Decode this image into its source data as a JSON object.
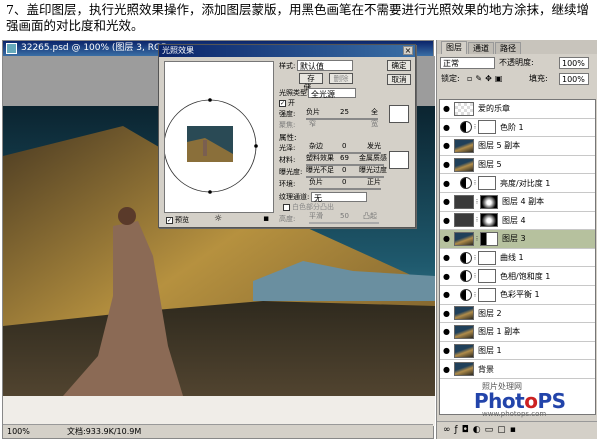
{
  "instruction": "7、盖印图层，执行光照效果操作，添加图层蒙版，用黑色画笔在不需要进行光照效果的地方涂抹，继续增强画面的对比度和光效。",
  "window": {
    "title": "32265.psd @ 100% (图层 3, RGB",
    "zoom": "100%",
    "doc_size": "文档:933.9K/10.9M"
  },
  "dialog": {
    "title": "光照效果",
    "style_label": "样式:",
    "style_value": "默认值",
    "save_label": "存储...",
    "delete_label": "删除",
    "ok_label": "确定",
    "cancel_label": "取消",
    "light_type_label": "光照类型:",
    "light_type_value": "全光源",
    "on_label": "开",
    "intensity_label": "强度:",
    "intensity_min": "负片",
    "intensity_value": "25",
    "intensity_max": "全",
    "focus_label": "聚焦:",
    "focus_min": "窄",
    "focus_max": "宽",
    "properties_label": "属性:",
    "gloss_label": "光泽:",
    "gloss_min": "杂边",
    "gloss_value": "0",
    "gloss_max": "发光",
    "material_label": "材料:",
    "material_min": "塑料效果",
    "material_value": "69",
    "material_max": "金属质感",
    "exposure_label": "曝光度:",
    "exposure_min": "曝光不足",
    "exposure_value": "0",
    "exposure_max": "曝光过度",
    "ambience_label": "环境:",
    "ambience_min": "负片",
    "ambience_value": "0",
    "ambience_max": "正片",
    "texture_label": "纹理通道:",
    "texture_value": "无",
    "white_high_label": "白色部分凸出",
    "height_label": "高度:",
    "height_min": "平滑",
    "height_value": "50",
    "height_max": "凸起",
    "preview_label": "预览"
  },
  "layers_panel": {
    "tabs": [
      "图层",
      "通道",
      "路径"
    ],
    "blend_mode": "正常",
    "opacity_label": "不透明度:",
    "opacity_value": "100%",
    "lock_label": "锁定:",
    "fill_label": "填充:",
    "fill_value": "100%",
    "layers": [
      {
        "name": "爱的乐章",
        "kind": "text"
      },
      {
        "name": "色阶 1",
        "kind": "adjustment"
      },
      {
        "name": "图层 5 副本",
        "kind": "image"
      },
      {
        "name": "图层 5",
        "kind": "image"
      },
      {
        "name": "亮度/对比度 1",
        "kind": "adjustment"
      },
      {
        "name": "图层 4 副本",
        "kind": "mask"
      },
      {
        "name": "图层 4",
        "kind": "mask"
      },
      {
        "name": "图层 3",
        "kind": "image_mask",
        "selected": true
      },
      {
        "name": "曲线 1",
        "kind": "adjustment"
      },
      {
        "name": "色相/饱和度 1",
        "kind": "adjustment"
      },
      {
        "name": "色彩平衡 1",
        "kind": "adjustment"
      },
      {
        "name": "图层 2",
        "kind": "image"
      },
      {
        "name": "图层 1 副本",
        "kind": "image"
      },
      {
        "name": "图层 1",
        "kind": "image"
      },
      {
        "name": "背景",
        "kind": "image"
      }
    ]
  },
  "watermark": {
    "line1": "照片处理网",
    "logo_text": "PhotoPS",
    "url": "www.photops.com"
  },
  "colors": {
    "selected_layer": "#b6c19e",
    "titlebar": "#0a246a",
    "logo_blue": "#2244aa",
    "logo_red": "#cc2222"
  },
  "icons": {
    "eye": "eye-icon",
    "link": "chain-link-icon",
    "trash": "trash-icon",
    "bulb": "light-bulb-icon"
  }
}
